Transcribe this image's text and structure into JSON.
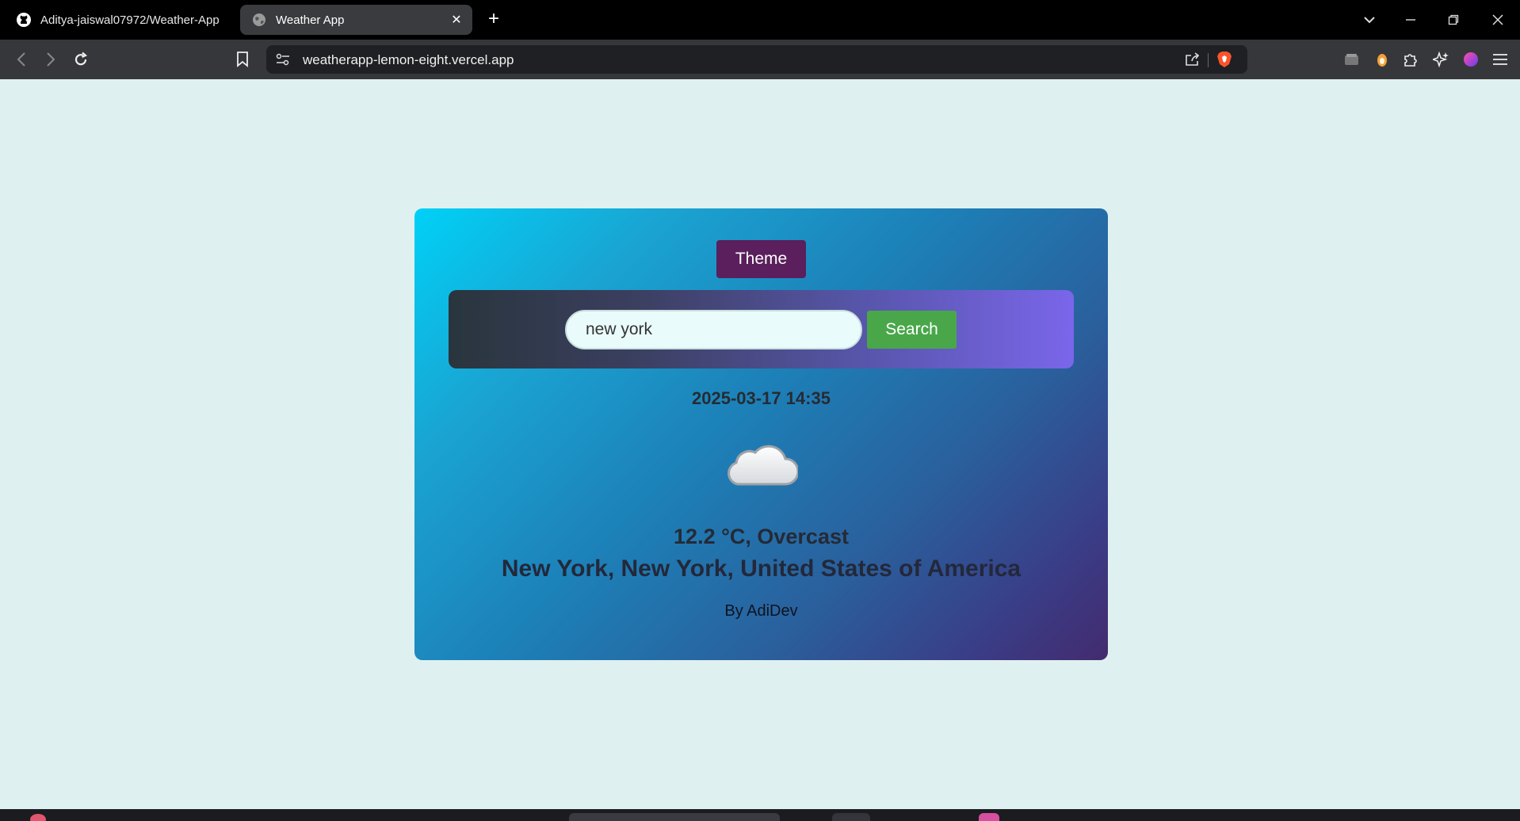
{
  "browser": {
    "tabs": [
      {
        "title": "Aditya-jaiswal07972/Weather-App",
        "icon": "github-icon"
      },
      {
        "title": "Weather App",
        "icon": "globe-icon",
        "active": true
      }
    ],
    "url": "weatherapp-lemon-eight.vercel.app"
  },
  "app": {
    "theme_label": "Theme",
    "search": {
      "value": "new york",
      "button_label": "Search"
    },
    "datetime": "2025-03-17 14:35",
    "weather_icon": "cloud-icon",
    "temperature_condition": "12.2 °C, Overcast",
    "location": "New York, New York, United States of America",
    "byline": "By AdiDev"
  },
  "colors": {
    "page_background": "#dff0f0",
    "theme_button": "#5a1f5c",
    "search_button": "#49a74a",
    "card_gradient_start": "#00d1f7",
    "card_gradient_end": "#432b6e"
  }
}
